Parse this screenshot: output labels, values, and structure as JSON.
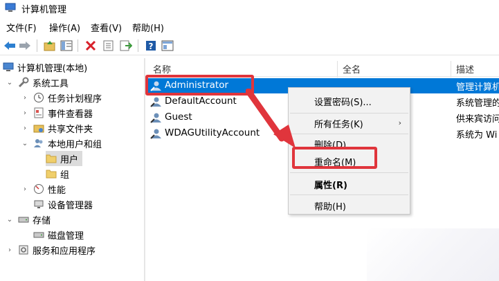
{
  "window": {
    "title": "计算机管理"
  },
  "menu": [
    {
      "label": "文件(F)"
    },
    {
      "label": "操作(A)"
    },
    {
      "label": "查看(V)"
    },
    {
      "label": "帮助(H)"
    }
  ],
  "toolbar_icons": [
    "back-icon",
    "forward-icon",
    "up-folder-icon",
    "show-hide-tree-icon",
    "delete-icon",
    "properties-icon",
    "export-icon",
    "help-icon",
    "console-view-icon"
  ],
  "tree": {
    "root": "计算机管理(本地)",
    "system_tools": "系统工具",
    "task_scheduler": "任务计划程序",
    "event_viewer": "事件查看器",
    "shared_folders": "共享文件夹",
    "local_users_groups": "本地用户和组",
    "users": "用户",
    "groups": "组",
    "performance": "性能",
    "device_manager": "设备管理器",
    "storage": "存储",
    "disk_management": "磁盘管理",
    "services_apps": "服务和应用程序"
  },
  "list": {
    "columns": [
      "名称",
      "全名",
      "描述"
    ],
    "rows": [
      {
        "name": "Administrator",
        "desc": "管理计算机"
      },
      {
        "name": "DefaultAccount",
        "desc": "系统管理的"
      },
      {
        "name": "Guest",
        "desc": "供来宾访问"
      },
      {
        "name": "WDAGUtilityAccount",
        "desc": "系统为 Wi"
      }
    ]
  },
  "context_menu": {
    "set_password": "设置密码(S)...",
    "all_tasks": "所有任务(K)",
    "delete": "删除(D)",
    "rename": "重命名(M)",
    "properties": "属性(R)",
    "help": "帮助(H)"
  },
  "colors": {
    "selection": "#0078d7",
    "highlight": "#e0353c"
  }
}
